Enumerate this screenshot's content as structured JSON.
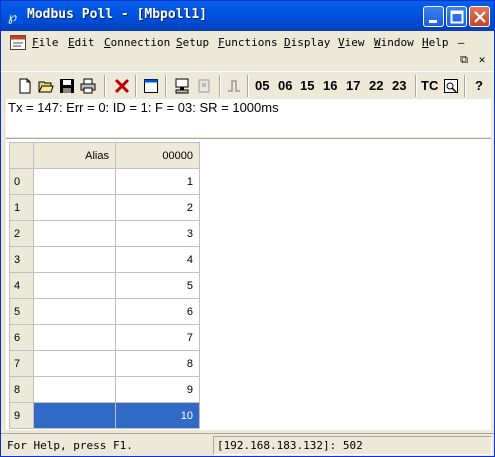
{
  "window": {
    "title": "Modbus Poll - [Mbpoll1]"
  },
  "menu": {
    "items": [
      {
        "u": "F",
        "rest": "ile"
      },
      {
        "u": "E",
        "rest": "dit"
      },
      {
        "u": "C",
        "rest": "onnection"
      },
      {
        "u": "S",
        "rest": "etup"
      },
      {
        "u": "F",
        "rest": "unctions"
      },
      {
        "u": "D",
        "rest": "isplay"
      },
      {
        "u": "V",
        "rest": "iew"
      },
      {
        "u": "W",
        "rest": "indow"
      },
      {
        "u": "H",
        "rest": "elp"
      }
    ],
    "mdi_minimize": "–",
    "mdi_restore": "⧉",
    "mdi_close": "✕"
  },
  "toolbar": {
    "function_codes": [
      "05",
      "06",
      "15",
      "16",
      "17",
      "22",
      "23"
    ],
    "tc_label": "TC",
    "help_glyph": "?"
  },
  "info_line": "Tx = 147: Err = 0: ID = 1: F = 03: SR = 1000ms",
  "grid": {
    "headers": {
      "alias": "Alias",
      "address": "00000"
    },
    "rows": [
      {
        "index": "0",
        "alias": "",
        "value": "1"
      },
      {
        "index": "1",
        "alias": "",
        "value": "2"
      },
      {
        "index": "2",
        "alias": "",
        "value": "3"
      },
      {
        "index": "3",
        "alias": "",
        "value": "4"
      },
      {
        "index": "4",
        "alias": "",
        "value": "5"
      },
      {
        "index": "5",
        "alias": "",
        "value": "6"
      },
      {
        "index": "6",
        "alias": "",
        "value": "7"
      },
      {
        "index": "7",
        "alias": "",
        "value": "8"
      },
      {
        "index": "8",
        "alias": "",
        "value": "9"
      },
      {
        "index": "9",
        "alias": "",
        "value": "10"
      }
    ],
    "selected_row": 9
  },
  "status": {
    "left": "For Help, press F1.",
    "right": "[192.168.183.132]: 502"
  },
  "colors": {
    "titlebar": "#0054e3",
    "selection": "#316ac5"
  }
}
